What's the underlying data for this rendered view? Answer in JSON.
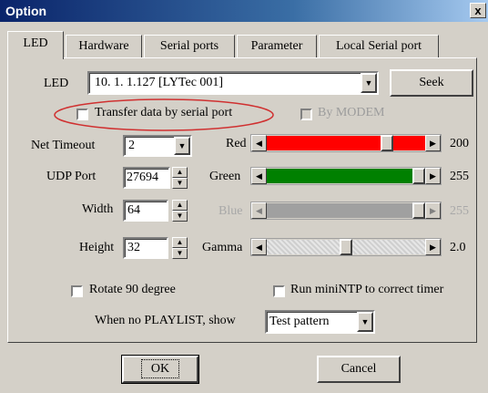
{
  "window": {
    "title": "Option",
    "close_label": "x"
  },
  "tabs": [
    "LED",
    "Hardware",
    "Serial ports",
    "Parameter",
    "Local Serial port"
  ],
  "led": {
    "label": "LED",
    "select_value": "10. 1. 1.127 [LYTec 001]",
    "seek_label": "Seek",
    "transfer_label": "Transfer data by serial port",
    "modem_label": "By MODEM"
  },
  "fields": {
    "net_timeout_label": "Net Timeout",
    "net_timeout_value": "2",
    "udp_port_label": "UDP Port",
    "udp_port_value": "27694",
    "width_label": "Width",
    "width_value": "64",
    "height_label": "Height",
    "height_value": "32"
  },
  "sliders": [
    {
      "label": "Red",
      "value": "200",
      "level": 0.784,
      "color": "#ff0000",
      "enabled": true
    },
    {
      "label": "Green",
      "value": "255",
      "level": 1.0,
      "color": "#008000",
      "enabled": true
    },
    {
      "label": "Blue",
      "value": "255",
      "level": 1.0,
      "color": "#a0a0a0",
      "enabled": false
    },
    {
      "label": "Gamma",
      "value": "2.0",
      "level": 0.5,
      "color": "#e0e0e0",
      "enabled": true
    }
  ],
  "options": {
    "rotate_label": "Rotate 90 degree",
    "ntp_label": "Run miniNTP to correct timer",
    "playlist_label": "When no PLAYLIST, show",
    "playlist_value": "Test pattern"
  },
  "buttons": {
    "ok": "OK",
    "cancel": "Cancel"
  },
  "colors": {
    "highlight_circle": "#d03030",
    "title_bar": "#0a246a"
  }
}
